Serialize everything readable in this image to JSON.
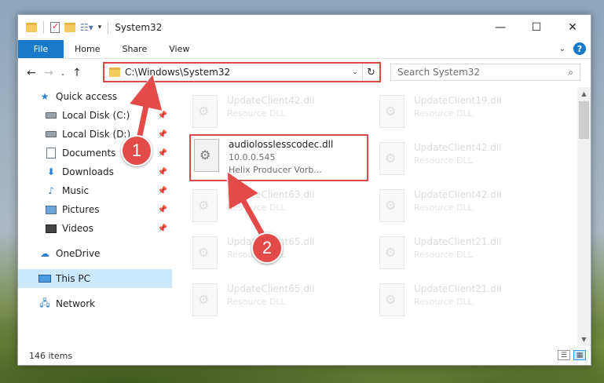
{
  "window": {
    "title": "System32",
    "controls": {
      "minimize": "—",
      "maximize": "☐",
      "close": "✕"
    }
  },
  "ribbon": {
    "file_tab": "File",
    "tabs": [
      "Home",
      "Share",
      "View"
    ]
  },
  "navigation": {
    "address": "C:\\Windows\\System32",
    "search_placeholder": "Search System32"
  },
  "sidebar": {
    "quick_access": "Quick access",
    "items": [
      {
        "label": "Local Disk (C:)"
      },
      {
        "label": "Local Disk (D:)"
      },
      {
        "label": "Documents"
      },
      {
        "label": "Downloads"
      },
      {
        "label": "Music"
      },
      {
        "label": "Pictures"
      },
      {
        "label": "Videos"
      }
    ],
    "onedrive": "OneDrive",
    "this_pc": "This PC",
    "network": "Network"
  },
  "files": {
    "highlighted": {
      "name": "audiolosslesscodec.dll",
      "version": "10.0.0.545",
      "description": "Helix Producer Vorb..."
    },
    "left_column": [
      {
        "name": "UpdateClient42.dll",
        "type": "Resource DLL"
      },
      {
        "name": "UpdateClient63.dll",
        "type": "Resource DLL"
      },
      {
        "name": "UpdateClient65.dll",
        "type": "Resource DLL"
      },
      {
        "name": "UpdateClient65.dll",
        "type": "Resource DLL"
      }
    ],
    "right_column": [
      {
        "name": "UpdateClient19.dll",
        "type": "Resource DLL"
      },
      {
        "name": "UpdateClient42.dll",
        "type": "Resource DLL"
      },
      {
        "name": "UpdateClient42.dll",
        "type": "Resource DLL"
      },
      {
        "name": "UpdateClient21.dll",
        "type": "Resource DLL"
      },
      {
        "name": "UpdateClient21.dll",
        "type": "Resource DLL"
      }
    ]
  },
  "status": {
    "item_count": "146 items"
  },
  "annotations": {
    "step1": "1",
    "step2": "2"
  },
  "colors": {
    "accent": "#1979ca",
    "highlight_border": "#d84b4b",
    "badge": "#e34b4b"
  }
}
